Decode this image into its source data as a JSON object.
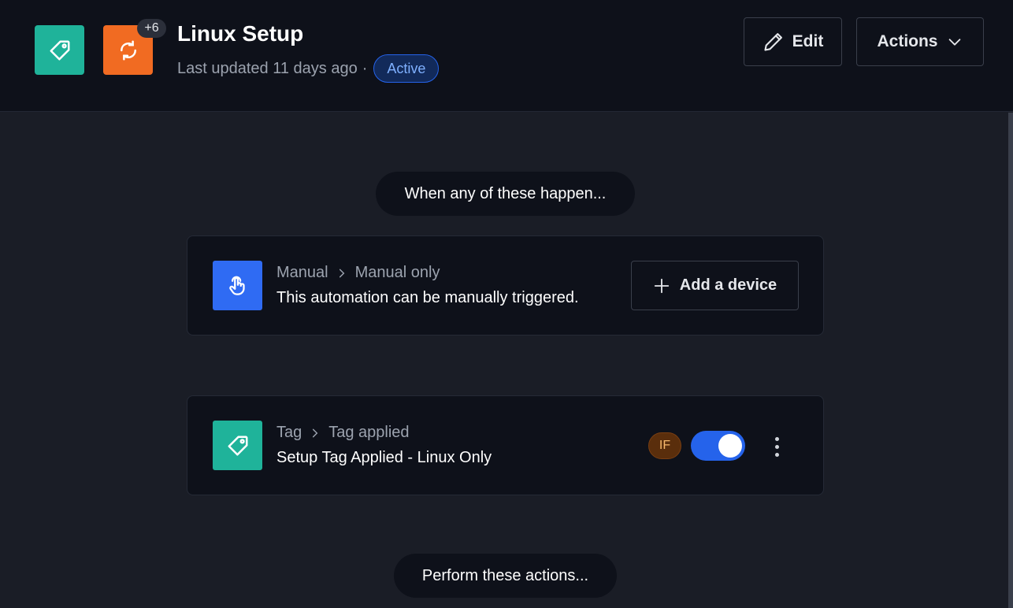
{
  "header": {
    "title": "Linux Setup",
    "more_apps_count": "+6",
    "last_updated": "Last updated 11 days ago",
    "separator": "·",
    "status": "Active",
    "edit_label": "Edit",
    "actions_label": "Actions",
    "icons": [
      "tag-icon",
      "sync-icon"
    ]
  },
  "flow": {
    "when_label": "When any of these happen...",
    "perform_label": "Perform these actions..."
  },
  "trigger_card": {
    "category": "Manual",
    "subcategory": "Manual only",
    "description": "This automation can be manually triggered.",
    "add_device_label": "Add a device",
    "icon": "hand-pointer-icon"
  },
  "condition_card": {
    "category": "Tag",
    "subcategory": "Tag applied",
    "description": "Setup Tag Applied - Linux Only",
    "if_label": "IF",
    "enabled": true,
    "icon": "tag-icon"
  },
  "colors": {
    "teal": "#1fb39a",
    "orange": "#f16b22",
    "blue": "#2f6bf3",
    "toggle_on": "#2563eb"
  }
}
